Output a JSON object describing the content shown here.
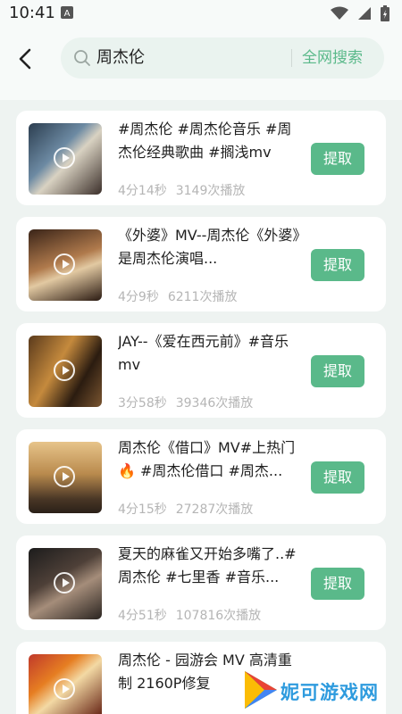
{
  "status_bar": {
    "time": "10:41",
    "notification_letter": "A"
  },
  "search": {
    "query": "周杰伦",
    "web_search_label": "全网搜索"
  },
  "results": [
    {
      "title": "#周杰伦 #周杰伦音乐 #周杰伦经典歌曲 #搁浅mv",
      "duration": "4分14秒",
      "plays": "3149次播放",
      "action": "提取"
    },
    {
      "title": "《外婆》MV--周杰伦《外婆》是周杰伦演唱...",
      "duration": "4分9秒",
      "plays": "6211次播放",
      "action": "提取"
    },
    {
      "title": "JAY--《爱在西元前》#音乐mv",
      "duration": "3分58秒",
      "plays": "39346次播放",
      "action": "提取"
    },
    {
      "title": "周杰伦《借口》MV#上热门🔥 #周杰伦借口 #周杰...",
      "duration": "4分15秒",
      "plays": "27287次播放",
      "action": "提取"
    },
    {
      "title": "夏天的麻雀又开始多嘴了..#周杰伦 #七里香 #音乐...",
      "duration": "4分51秒",
      "plays": "107816次播放",
      "action": "提取"
    },
    {
      "title": "周杰伦 - 园游会 MV 高清重制 2160P修复",
      "duration": "",
      "plays": "",
      "action": ""
    }
  ],
  "watermark": {
    "text": "妮可游戏网"
  },
  "colors": {
    "accent": "#5ab98a",
    "background": "#eef3f1",
    "card": "#ffffff"
  }
}
